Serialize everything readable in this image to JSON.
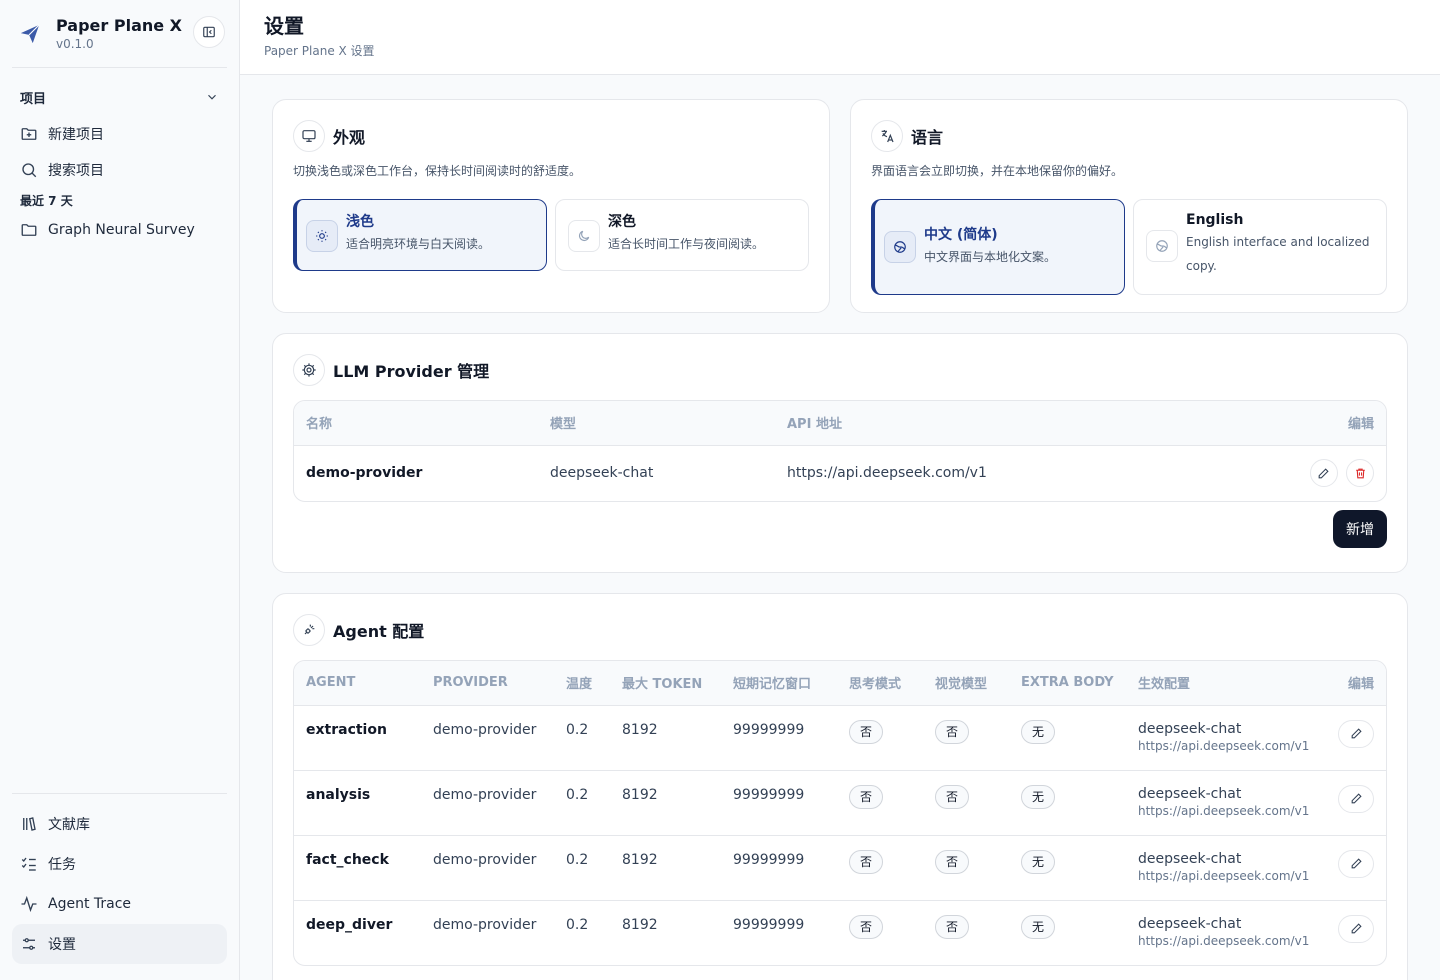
{
  "app": {
    "name": "Paper Plane X",
    "version": "v0.1.0"
  },
  "sidebar": {
    "projects_label": "项目",
    "new_project": "新建项目",
    "search_project": "搜索项目",
    "recent_label": "最近 7 天",
    "recent_items": [
      "Graph Neural Survey"
    ],
    "bottom": {
      "library": "文献库",
      "tasks": "任务",
      "trace": "Agent Trace",
      "settings": "设置"
    }
  },
  "header": {
    "title": "设置",
    "subtitle": "Paper Plane X 设置"
  },
  "appearance": {
    "title": "外观",
    "desc": "切换浅色或深色工作台，保持长时间阅读时的舒适度。",
    "light": {
      "title": "浅色",
      "desc": "适合明亮环境与白天阅读。"
    },
    "dark": {
      "title": "深色",
      "desc": "适合长时间工作与夜间阅读。"
    }
  },
  "language": {
    "title": "语言",
    "desc": "界面语言会立即切换，并在本地保留你的偏好。",
    "zh": {
      "title": "中文 (简体)",
      "desc": "中文界面与本地化文案。"
    },
    "en": {
      "title": "English",
      "desc": "English interface and localized copy."
    }
  },
  "llm": {
    "title": "LLM Provider 管理",
    "headers": {
      "name": "名称",
      "model": "模型",
      "api": "API 地址",
      "edit": "编辑"
    },
    "row": {
      "name": "demo-provider",
      "model": "deepseek-chat",
      "api": "https://api.deepseek.com/v1"
    },
    "add": "新增"
  },
  "agent": {
    "title": "Agent 配置",
    "headers": {
      "agent": "AGENT",
      "provider": "PROVIDER",
      "temp": "温度",
      "max_token": "最大 TOKEN",
      "window": "短期记忆窗口",
      "thinking": "思考模式",
      "vision": "视觉模型",
      "extra": "EXTRA BODY",
      "effective": "生效配置",
      "edit": "编辑"
    },
    "rows": [
      {
        "agent": "extraction",
        "provider": "demo-provider",
        "temp": "0.2",
        "max_token": "8192",
        "window": "99999999",
        "thinking": "否",
        "vision": "否",
        "extra": "无",
        "model": "deepseek-chat",
        "url": "https://api.deepseek.com/v1"
      },
      {
        "agent": "analysis",
        "provider": "demo-provider",
        "temp": "0.2",
        "max_token": "8192",
        "window": "99999999",
        "thinking": "否",
        "vision": "否",
        "extra": "无",
        "model": "deepseek-chat",
        "url": "https://api.deepseek.com/v1"
      },
      {
        "agent": "fact_check",
        "provider": "demo-provider",
        "temp": "0.2",
        "max_token": "8192",
        "window": "99999999",
        "thinking": "否",
        "vision": "否",
        "extra": "无",
        "model": "deepseek-chat",
        "url": "https://api.deepseek.com/v1"
      },
      {
        "agent": "deep_diver",
        "provider": "demo-provider",
        "temp": "0.2",
        "max_token": "8192",
        "window": "99999999",
        "thinking": "否",
        "vision": "否",
        "extra": "无",
        "model": "deepseek-chat",
        "url": "https://api.deepseek.com/v1"
      }
    ]
  },
  "colors": {
    "accent": "#1e3a8a",
    "primary_button": "#0f172a",
    "danger": "#dc2626"
  }
}
